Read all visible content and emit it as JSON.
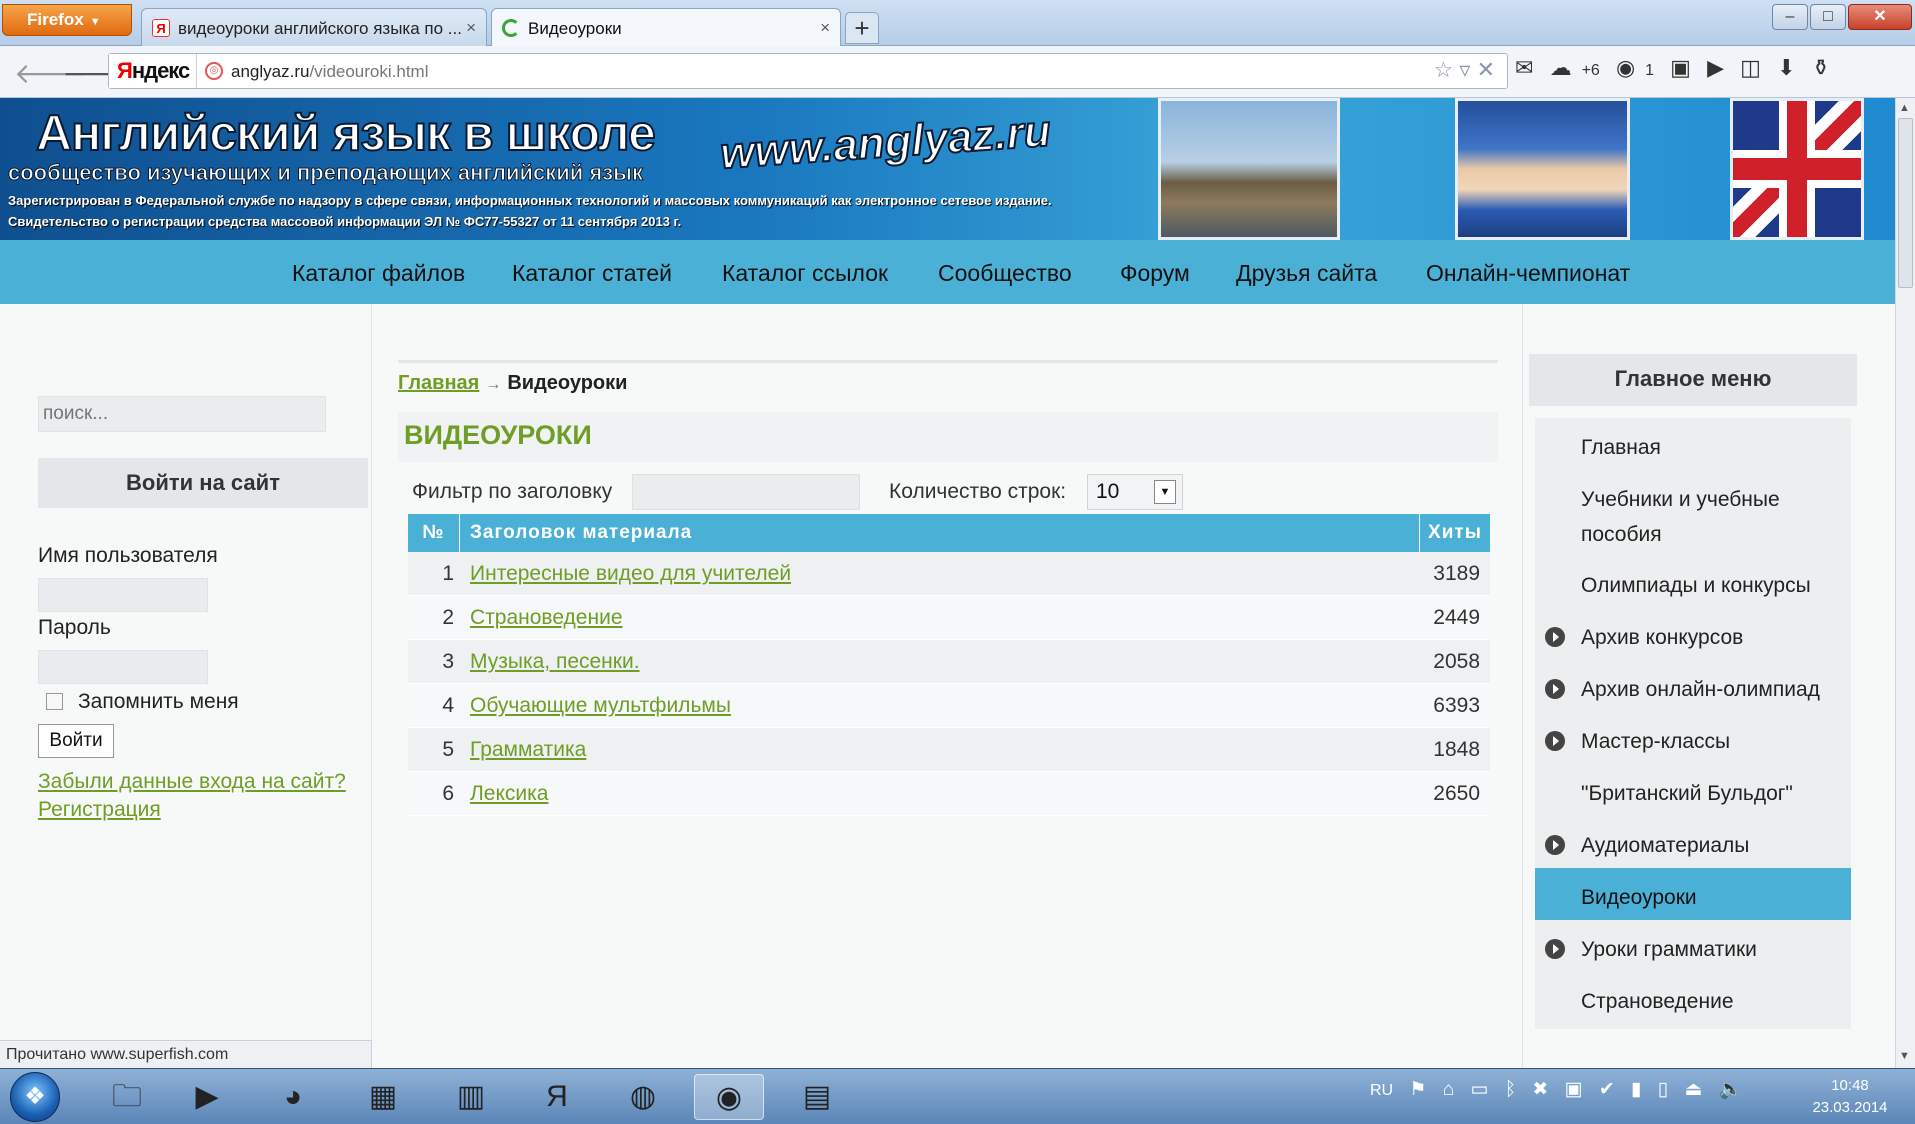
{
  "browser": {
    "app_button": "Firefox",
    "tabs": [
      {
        "title": "видеоуроки английского языка по ...",
        "favicon": "yandex-icon"
      },
      {
        "title": "Видеоуроки",
        "favicon": "loading-icon"
      }
    ],
    "new_tab": "+",
    "window_controls": {
      "minimize": "–",
      "maximize": "□",
      "close": "✕"
    },
    "search_engine": {
      "prefix": "Я",
      "rest": "ндекс"
    },
    "url": {
      "host": "anglyaz.ru",
      "path": "/videouroki.html"
    },
    "toolbar": {
      "weather": "+6",
      "badge": "1"
    }
  },
  "site": {
    "title": "Английский язык в школе",
    "subtitle": "сообщество изучающих и преподающих английский язык",
    "registration": "Зарегистрирован в Федеральной службе по надзору в сфере связи, информационных технологий и массовых коммуникаций как электронное сетевое издание. Свидетельство о регистрации средства массовой информации ЭЛ № ФС77-55327 от 11 сентября 2013 г.",
    "url_logo": "www.anglyaz.ru",
    "top_menu": [
      "Каталог файлов",
      "Каталог статей",
      "Каталог ссылок",
      "Сообщество",
      "Форум",
      "Друзья сайта",
      "Онлайн-чемпионат"
    ]
  },
  "sidebar_left": {
    "search_placeholder": "поиск...",
    "login_header": "Войти на сайт",
    "username_label": "Имя пользователя",
    "password_label": "Пароль",
    "remember_label": "Запомнить меня",
    "login_button": "Войти",
    "forgot_link": "Забыли данные входа на сайт?",
    "register_link": "Регистрация"
  },
  "main": {
    "breadcrumb": {
      "home": "Главная",
      "separator": "→",
      "current": "Видеоуроки"
    },
    "heading": "ВИДЕОУРОКИ",
    "filter_label": "Фильтр по заголовку",
    "rows_label": "Количество строк:",
    "rows_value": "10",
    "table": {
      "headers": {
        "num": "№",
        "title": "Заголовок материала",
        "hits": "Хиты"
      },
      "rows": [
        {
          "num": "1",
          "title": "Интересные видео для учителей",
          "hits": "3189"
        },
        {
          "num": "2",
          "title": "Страноведение",
          "hits": "2449"
        },
        {
          "num": "3",
          "title": "Музыка, песенки.",
          "hits": "2058"
        },
        {
          "num": "4",
          "title": "Обучающие мультфильмы",
          "hits": "6393"
        },
        {
          "num": "5",
          "title": "Грамматика",
          "hits": "1848"
        },
        {
          "num": "6",
          "title": "Лексика",
          "hits": "2650"
        }
      ]
    }
  },
  "sidebar_right": {
    "header": "Главное меню",
    "items": [
      {
        "label": "Главная",
        "bullet": false,
        "active": false
      },
      {
        "label": "Учебники и учебные пособия",
        "bullet": false,
        "active": false
      },
      {
        "label": "Олимпиады и конкурсы",
        "bullet": false,
        "active": false
      },
      {
        "label": "Архив конкурсов",
        "bullet": true,
        "active": false
      },
      {
        "label": "Архив онлайн-олимпиад",
        "bullet": true,
        "active": false
      },
      {
        "label": "Мастер-классы",
        "bullet": true,
        "active": false
      },
      {
        "label": "\"Британский Бульдог\"",
        "bullet": false,
        "active": false
      },
      {
        "label": "Аудиоматериалы",
        "bullet": true,
        "active": false
      },
      {
        "label": "Видеоуроки",
        "bullet": false,
        "active": true
      },
      {
        "label": "Уроки грамматики",
        "bullet": true,
        "active": false
      },
      {
        "label": "Страноведение",
        "bullet": false,
        "active": false
      }
    ]
  },
  "status_bar": "Прочитано www.superfish.com",
  "taskbar": {
    "lang": "RU",
    "time": "10:48",
    "date": "23.03.2014"
  },
  "colors": {
    "accent_blue": "#4bb0d5",
    "link_green": "#6e9e26",
    "banner_blue": "#1a78bf"
  }
}
